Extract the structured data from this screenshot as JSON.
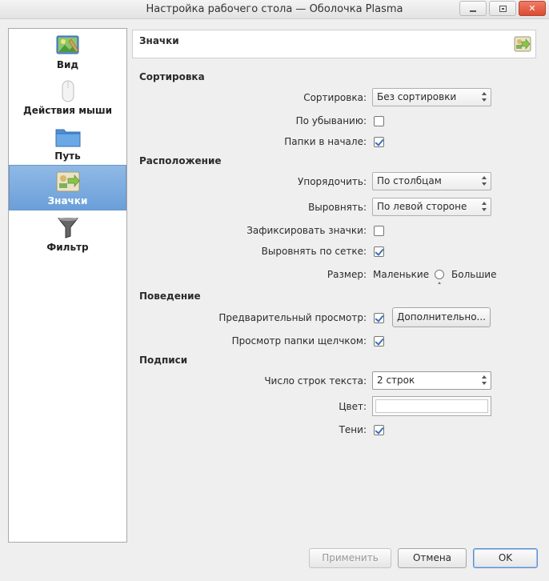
{
  "window": {
    "title": "Настройка рабочего стола — Оболочка Plasma",
    "close_glyph": "✕"
  },
  "sidebar": {
    "items": [
      {
        "label": "Вид",
        "icon": "wallpaper-icon"
      },
      {
        "label": "Действия мыши",
        "icon": "mouse-icon"
      },
      {
        "label": "Путь",
        "icon": "folder-icon"
      },
      {
        "label": "Значки",
        "icon": "icons-view-icon",
        "selected": true
      },
      {
        "label": "Фильтр",
        "icon": "filter-icon"
      }
    ]
  },
  "header": {
    "title": "Значки"
  },
  "sections": {
    "sorting": "Сортировка",
    "arrangement": "Расположение",
    "behavior": "Поведение",
    "captions": "Подписи"
  },
  "sorting": {
    "sort_label": "Сортировка:",
    "sort_value": "Без сортировки",
    "descending_label": "По убыванию:",
    "descending_checked": false,
    "folders_first_label": "Папки в начале:",
    "folders_first_checked": true
  },
  "arrangement": {
    "arrange_label": "Упорядочить:",
    "arrange_value": "По столбцам",
    "align_label": "Выровнять:",
    "align_value": "По левой стороне",
    "lock_label": "Зафиксировать значки:",
    "lock_checked": false,
    "grid_label": "Выровнять по сетке:",
    "grid_checked": true,
    "size_label": "Размер:",
    "size_small": "Маленькие",
    "size_large": "Большие"
  },
  "behavior": {
    "preview_label": "Предварительный просмотр:",
    "preview_checked": true,
    "more_button": "Дополнительно...",
    "click_label": "Просмотр папки щелчком:",
    "click_checked": true
  },
  "captions": {
    "lines_label": "Число строк текста:",
    "lines_value": "2 строк",
    "color_label": "Цвет:",
    "shadows_label": "Тени:",
    "shadows_checked": true
  },
  "footer": {
    "apply": "Применить",
    "cancel": "Отмена",
    "ok": "OK"
  }
}
